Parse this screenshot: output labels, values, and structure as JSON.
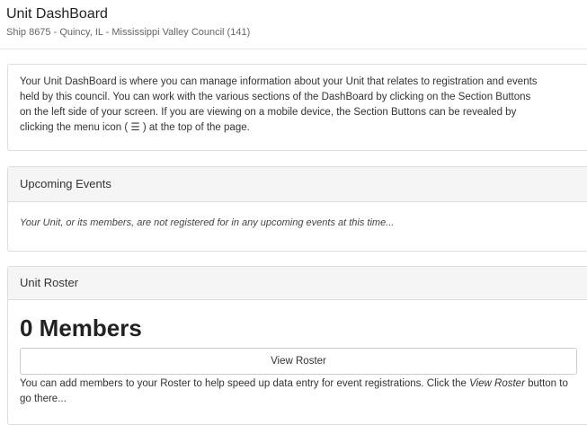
{
  "header": {
    "title": "Unit DashBoard",
    "subtitle": "Ship 8675 - Quincy, IL - Mississippi Valley Council (141)"
  },
  "intro": {
    "text_before_icon": "Your Unit DashBoard is where you can manage information about your Unit that relates to registration and events held by this council. You can work with the various sections of the DashBoard by clicking on the Section Buttons on the left side of your screen. If you are viewing on a mobile device, the Section Buttons can be revealed by clicking the menu icon ( ",
    "menu_icon_glyph": "☰",
    "text_after_icon": " ) at the top of the page."
  },
  "events": {
    "heading": "Upcoming Events",
    "message": "Your Unit, or its members, are not registered for in any upcoming events at this time..."
  },
  "roster": {
    "heading": "Unit Roster",
    "members_count": "0 Members",
    "view_button_label": "View Roster",
    "help_before": "You can add members to your Roster to help speed up data entry for event registrations. Click the ",
    "help_emphasis": "View Roster",
    "help_after": " button to go there..."
  }
}
